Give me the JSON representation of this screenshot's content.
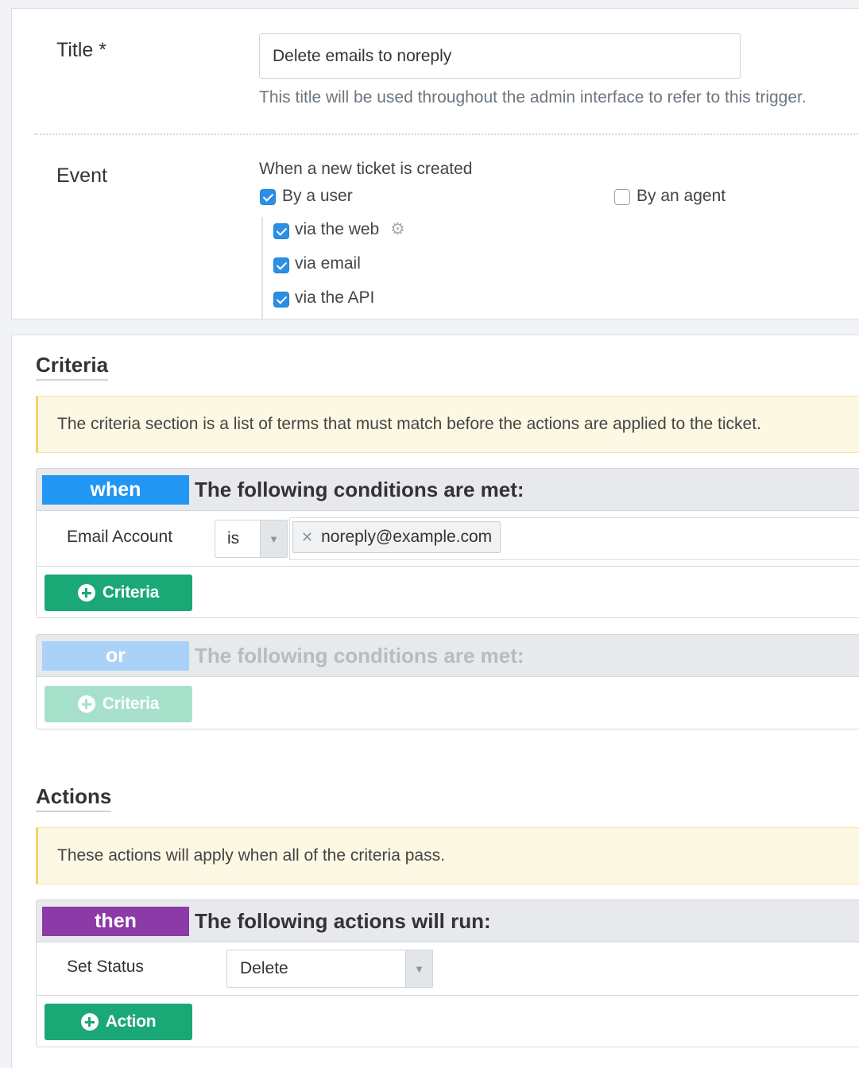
{
  "form": {
    "title_label": "Title *",
    "title_value": "Delete emails to noreply",
    "title_help": "This title will be used throughout the admin interface to refer to this trigger.",
    "event_label": "Event",
    "event_heading": "When a new ticket is created",
    "by_user": {
      "label": "By a user",
      "checked": true
    },
    "by_agent": {
      "label": "By an agent",
      "checked": false
    },
    "via_options": [
      {
        "label": "via the web",
        "checked": true,
        "icon": "gear-icon"
      },
      {
        "label": "via email",
        "checked": true
      },
      {
        "label": "via the API",
        "checked": true
      }
    ]
  },
  "criteria": {
    "title": "Criteria",
    "notice": "The criteria section is a list of terms that must match before the actions are applied to the ticket.",
    "when_group": {
      "tag": "when",
      "tag_color": "#2196f3",
      "heading": "The following conditions are met:",
      "rule": {
        "field": "Email Account",
        "operator": "is",
        "value": "noreply@example.com"
      },
      "button_label": "Criteria"
    },
    "or_group": {
      "tag": "or",
      "tag_color": "#a9d2f9",
      "heading": "The following conditions are met:",
      "button_label": "Criteria"
    }
  },
  "actions": {
    "title": "Actions",
    "notice": "These actions will apply when all of the criteria pass.",
    "then_group": {
      "tag": "then",
      "tag_color": "#8b3aa8",
      "heading": "The following actions will run:",
      "rule": {
        "field": "Set Status",
        "value": "Delete"
      },
      "button_label": "Action"
    }
  },
  "colors": {
    "green_button": "#1aa876",
    "green_button_disabled": "#a7e1cc",
    "checkbox_blue": "#2b8fe5"
  }
}
